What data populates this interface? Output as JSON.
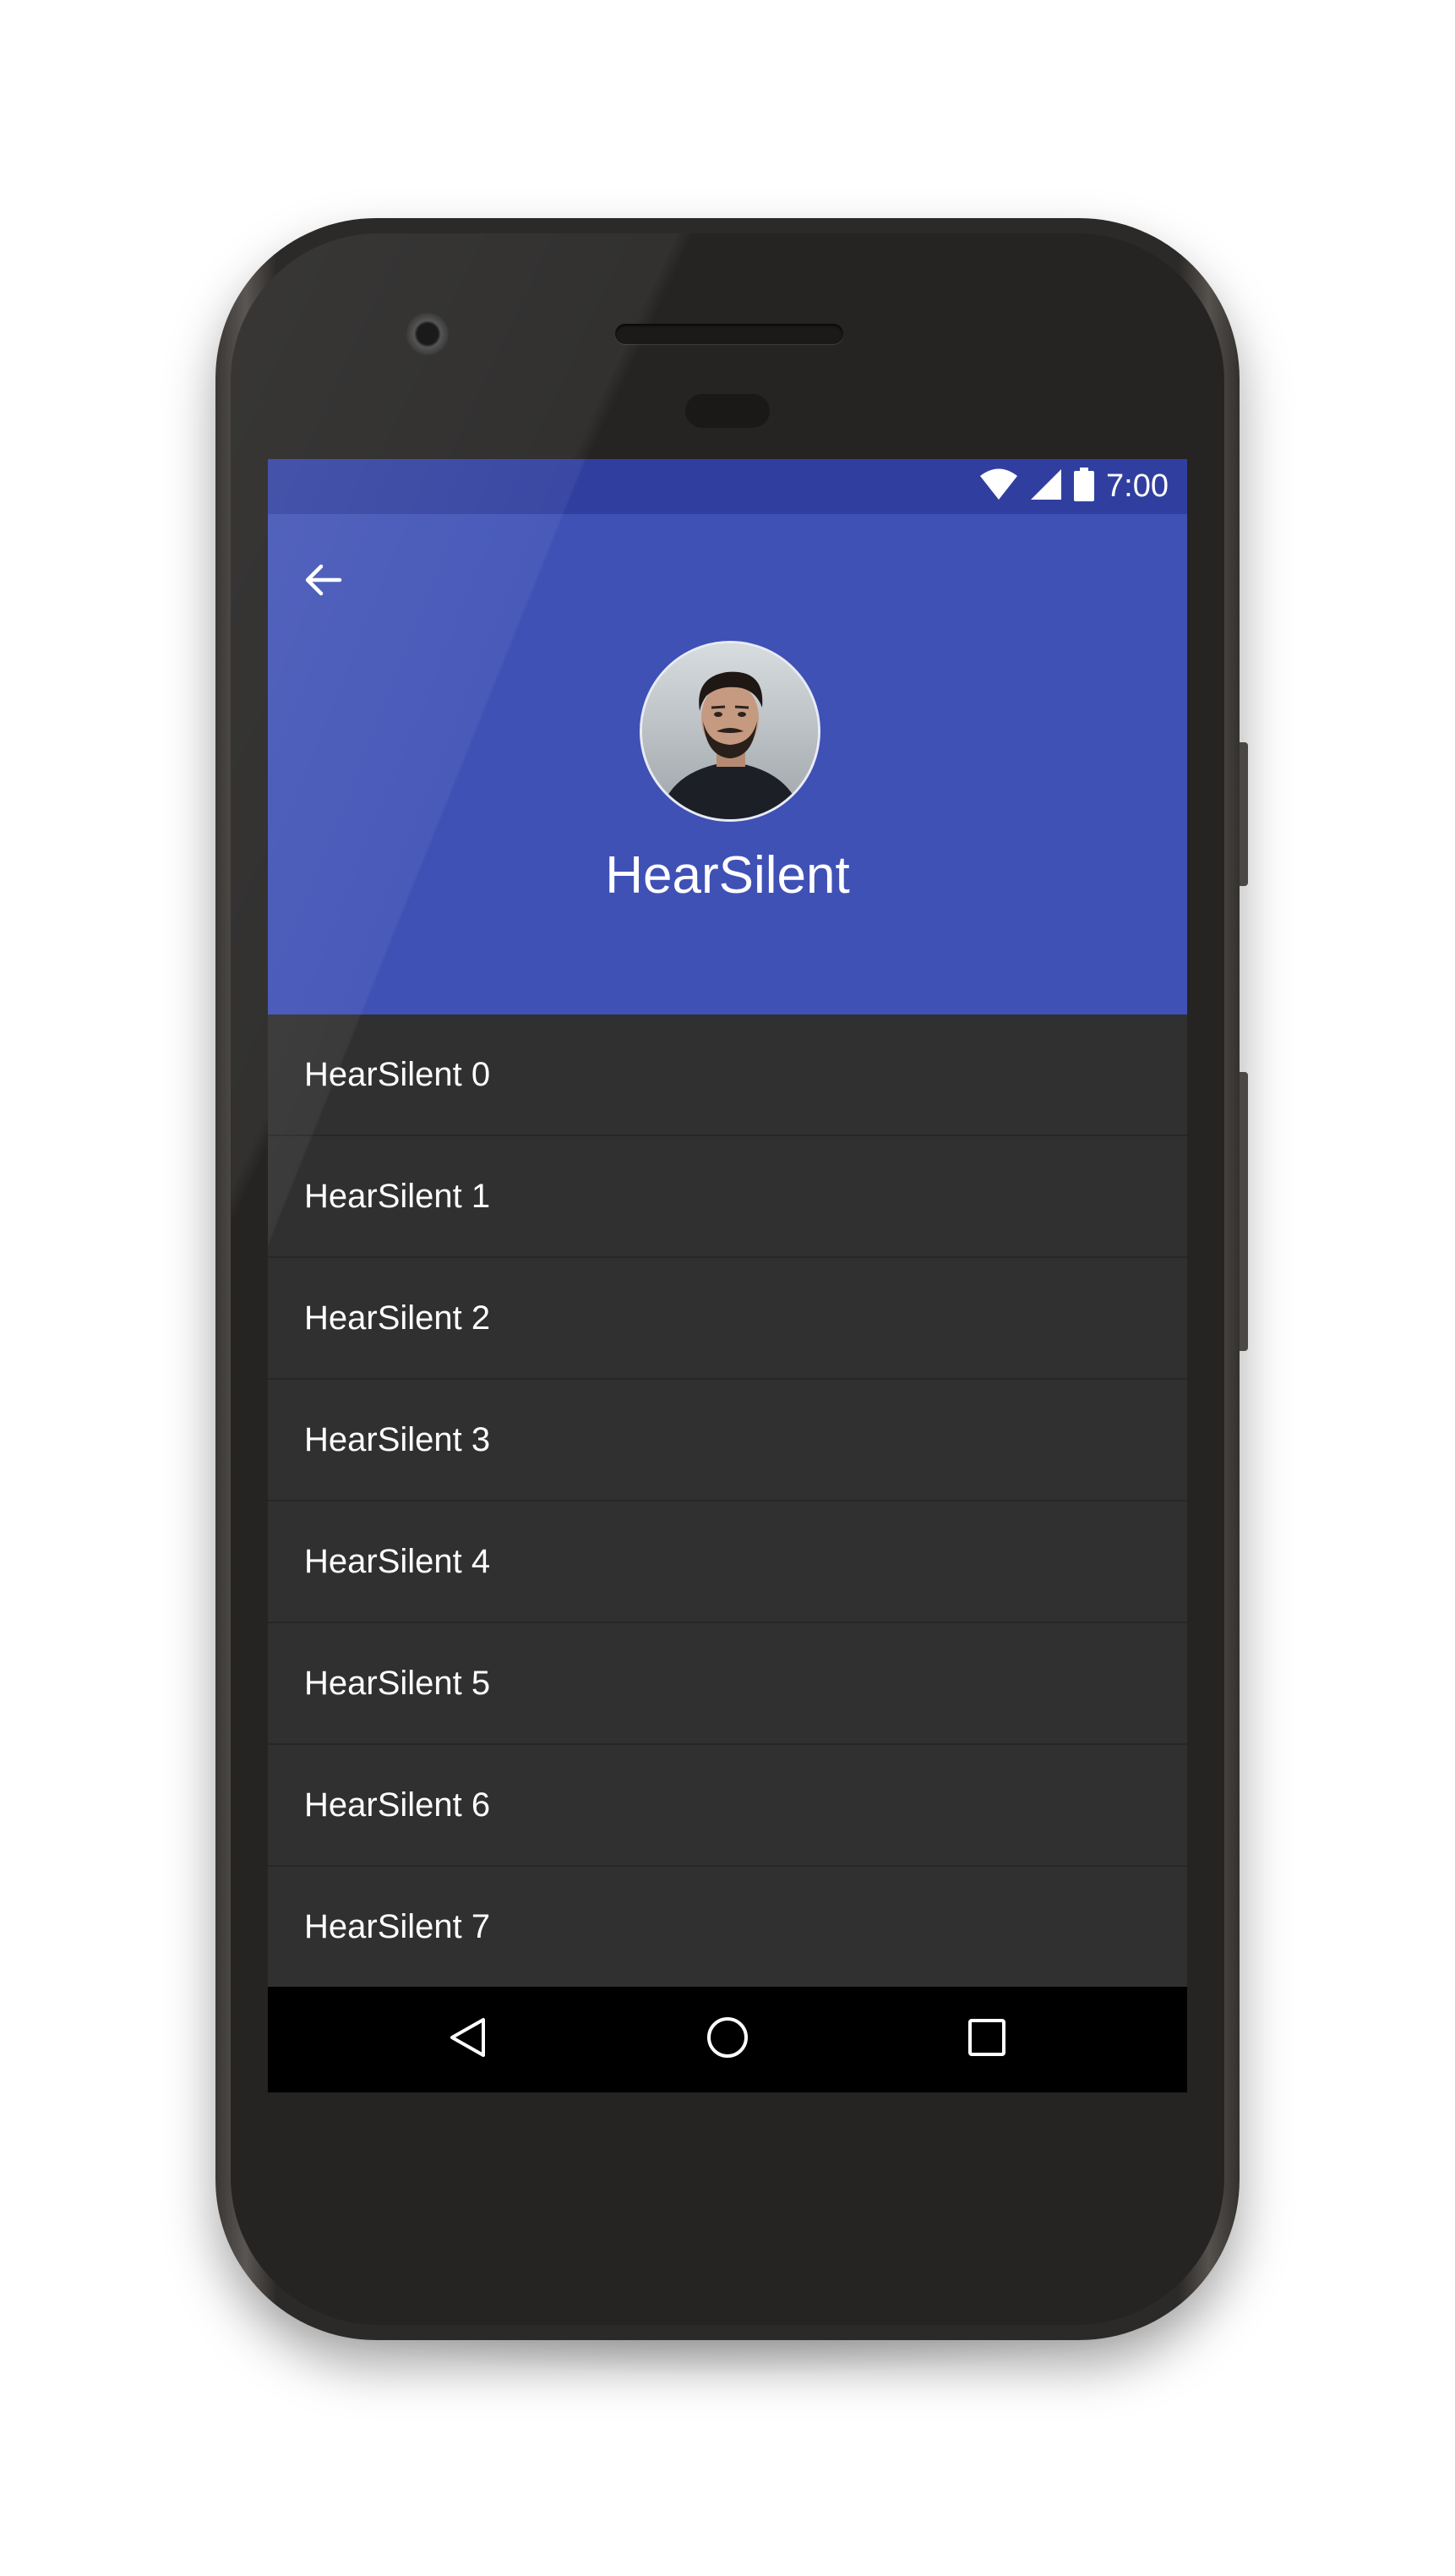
{
  "status_bar": {
    "time": "7:00",
    "icons": [
      "wifi-icon",
      "signal-icon",
      "battery-icon"
    ]
  },
  "header": {
    "back_icon": "arrow-back-icon",
    "profile_name": "HearSilent",
    "avatar": "profile-avatar"
  },
  "list": {
    "items": [
      {
        "label": "HearSilent 0"
      },
      {
        "label": "HearSilent 1"
      },
      {
        "label": "HearSilent 2"
      },
      {
        "label": "HearSilent 3"
      },
      {
        "label": "HearSilent 4"
      },
      {
        "label": "HearSilent 5"
      },
      {
        "label": "HearSilent 6"
      },
      {
        "label": "HearSilent 7"
      }
    ]
  },
  "nav_bar": {
    "buttons": [
      "back-triangle-icon",
      "home-circle-icon",
      "recents-square-icon"
    ]
  },
  "colors": {
    "primary": "#3f51b5",
    "primary_dark": "#303f9f",
    "list_background": "#303030",
    "nav_background": "#000000",
    "text": "#ffffff"
  }
}
